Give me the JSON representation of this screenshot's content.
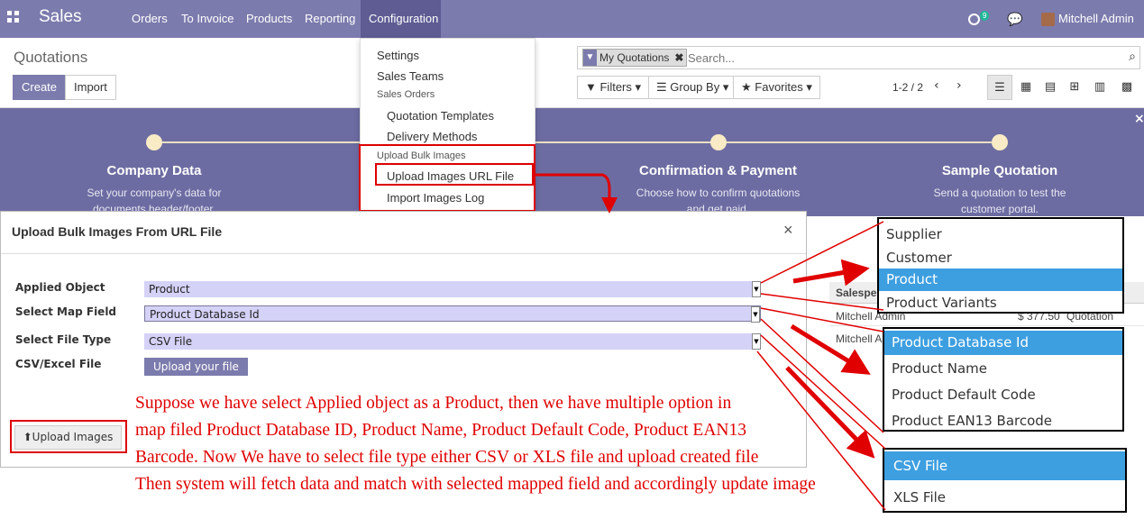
{
  "navbar": {
    "brand": "Sales",
    "menu": [
      "Orders",
      "To Invoice",
      "Products",
      "Reporting",
      "Configuration"
    ],
    "badge": "9",
    "user": "Mitchell Admin"
  },
  "control": {
    "title": "Quotations",
    "create": "Create",
    "import": "Import",
    "facet": "My Quotations",
    "search_placeholder": "Search...",
    "filters": "Filters",
    "group_by": "Group By",
    "favorites": "Favorites",
    "pager": "1-2 / 2"
  },
  "banner": {
    "steps": [
      {
        "title": "Company Data",
        "desc": [
          "Set your company's data for",
          "documents header/footer."
        ]
      },
      {
        "title": "Confirmation & Payment",
        "desc": [
          "Choose how to confirm quotations",
          "and get paid."
        ]
      },
      {
        "title": "Sample Quotation",
        "desc": [
          "Send a quotation to test the",
          "customer portal."
        ]
      }
    ]
  },
  "config_menu": {
    "settings": "Settings",
    "sales_teams": "Sales Teams",
    "sales_orders": "Sales Orders",
    "quotation_templates": "Quotation Templates",
    "delivery_methods": "Delivery Methods",
    "upload_bulk_images": "Upload Bulk Images",
    "upload_images_url_file": "Upload Images URL File",
    "import_images_log": "Import Images Log"
  },
  "list": {
    "header": "Salespe",
    "rows": [
      {
        "salesperson": "Mitchell Admin",
        "amount": "$ 377.50",
        "status": "Quotation"
      },
      {
        "salesperson": "Mitchell A"
      }
    ]
  },
  "modal": {
    "title": "Upload Bulk Images From URL File",
    "close": "×",
    "applied_object_label": "Applied Object",
    "applied_object": "Product",
    "map_field_label": "Select Map Field",
    "map_field": "Product Database Id",
    "file_type_label": "Select File Type",
    "file_type": "CSV File",
    "file_label": "CSV/Excel File",
    "upload_file": "Upload your file",
    "upload_images": "Upload Images"
  },
  "annotation": [
    "Suppose we have select Applied object as a Product, then we have multiple option in",
    "map filed Product Database ID, Product Name, Product Default Code, Product EAN13",
    "Barcode. Now We have to select file type either CSV or XLS file and upload created file",
    "Then system will fetch data and match with selected mapped field and accordingly update image"
  ],
  "object_options": [
    "Supplier",
    "Customer",
    "Product",
    "Product Variants"
  ],
  "field_options": [
    "Product Database Id",
    "Product Name",
    "Product Default Code",
    "Product EAN13 Barcode"
  ],
  "filetype_options": [
    "CSV File",
    "XLS File"
  ],
  "colors": {
    "brand": "#7c7bad",
    "highlight": "#3d9fe0",
    "annotation": "#e00000"
  }
}
